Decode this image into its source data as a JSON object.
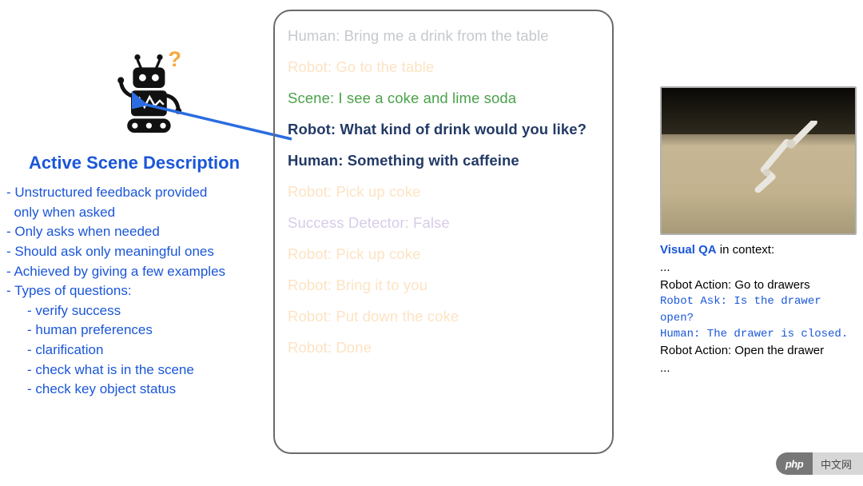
{
  "left": {
    "heading": "Active Scene Description",
    "bullets": {
      "b1a": "- Unstructured feedback provided",
      "b1b": "  only when asked",
      "b2": "- Only asks when needed",
      "b3": "- Should ask only meaningful ones",
      "b4": "- Achieved by giving a few examples",
      "b5": "- Types of questions:",
      "s1": "- verify success",
      "s2": "- human preferences",
      "s3": "- clarification",
      "s4": "- check what is in the scene",
      "s5": "- check key object status"
    }
  },
  "dialog": {
    "l0": "Human: Bring me a drink from the table",
    "l1": "Robot: Go to the table",
    "l2": "Scene: I see a coke and lime soda",
    "l3": "Robot: What kind of drink would you like?",
    "l4": "Human: Something with caffeine",
    "l5": "Robot: Pick up coke",
    "l6": "Success Detector: False",
    "l7": "Robot: Pick up coke",
    "l8": "Robot: Bring it to you",
    "l9": "Robot: Put down the coke",
    "l10": "Robot: Done"
  },
  "right": {
    "visual_qa": "Visual QA",
    "in_context": " in context:",
    "dots1": "...",
    "ra": "Robot Action: Go to drawers",
    "rask": "Robot Ask: Is the drawer open?",
    "hum": "Human: The drawer is closed.",
    "ra2": "Robot Action: Open the drawer",
    "dots2": "..."
  },
  "logo": {
    "php": "php",
    "site": "中文网"
  }
}
